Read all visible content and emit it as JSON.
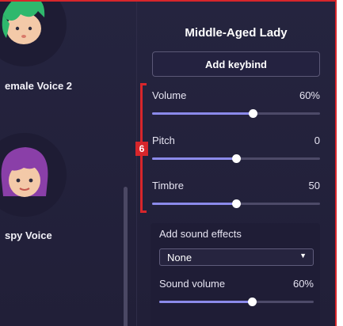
{
  "voices": [
    {
      "name": "emale Voice 2",
      "avatar": "green-hair-character-avatar"
    },
    {
      "name": "spy Voice",
      "avatar": "purple-hair-character-avatar"
    }
  ],
  "panel": {
    "title": "Middle-Aged Lady",
    "add_keybind_label": "Add keybind",
    "sliders": [
      {
        "label": "Volume",
        "value_text": "60%",
        "fraction": 0.6
      },
      {
        "label": "Pitch",
        "value_text": "0",
        "fraction": 0.5
      },
      {
        "label": "Timbre",
        "value_text": "50",
        "fraction": 0.5
      }
    ],
    "sound_effects": {
      "label": "Add sound effects",
      "selected": "None",
      "sound_volume_label": "Sound volume",
      "sound_volume_value": "60%",
      "sound_volume_fraction": 0.6
    }
  },
  "annotation": {
    "step_number": "6"
  },
  "colors": {
    "background": "#25243f",
    "accent": "#8b8aea",
    "annotation_red": "#d7262b"
  }
}
